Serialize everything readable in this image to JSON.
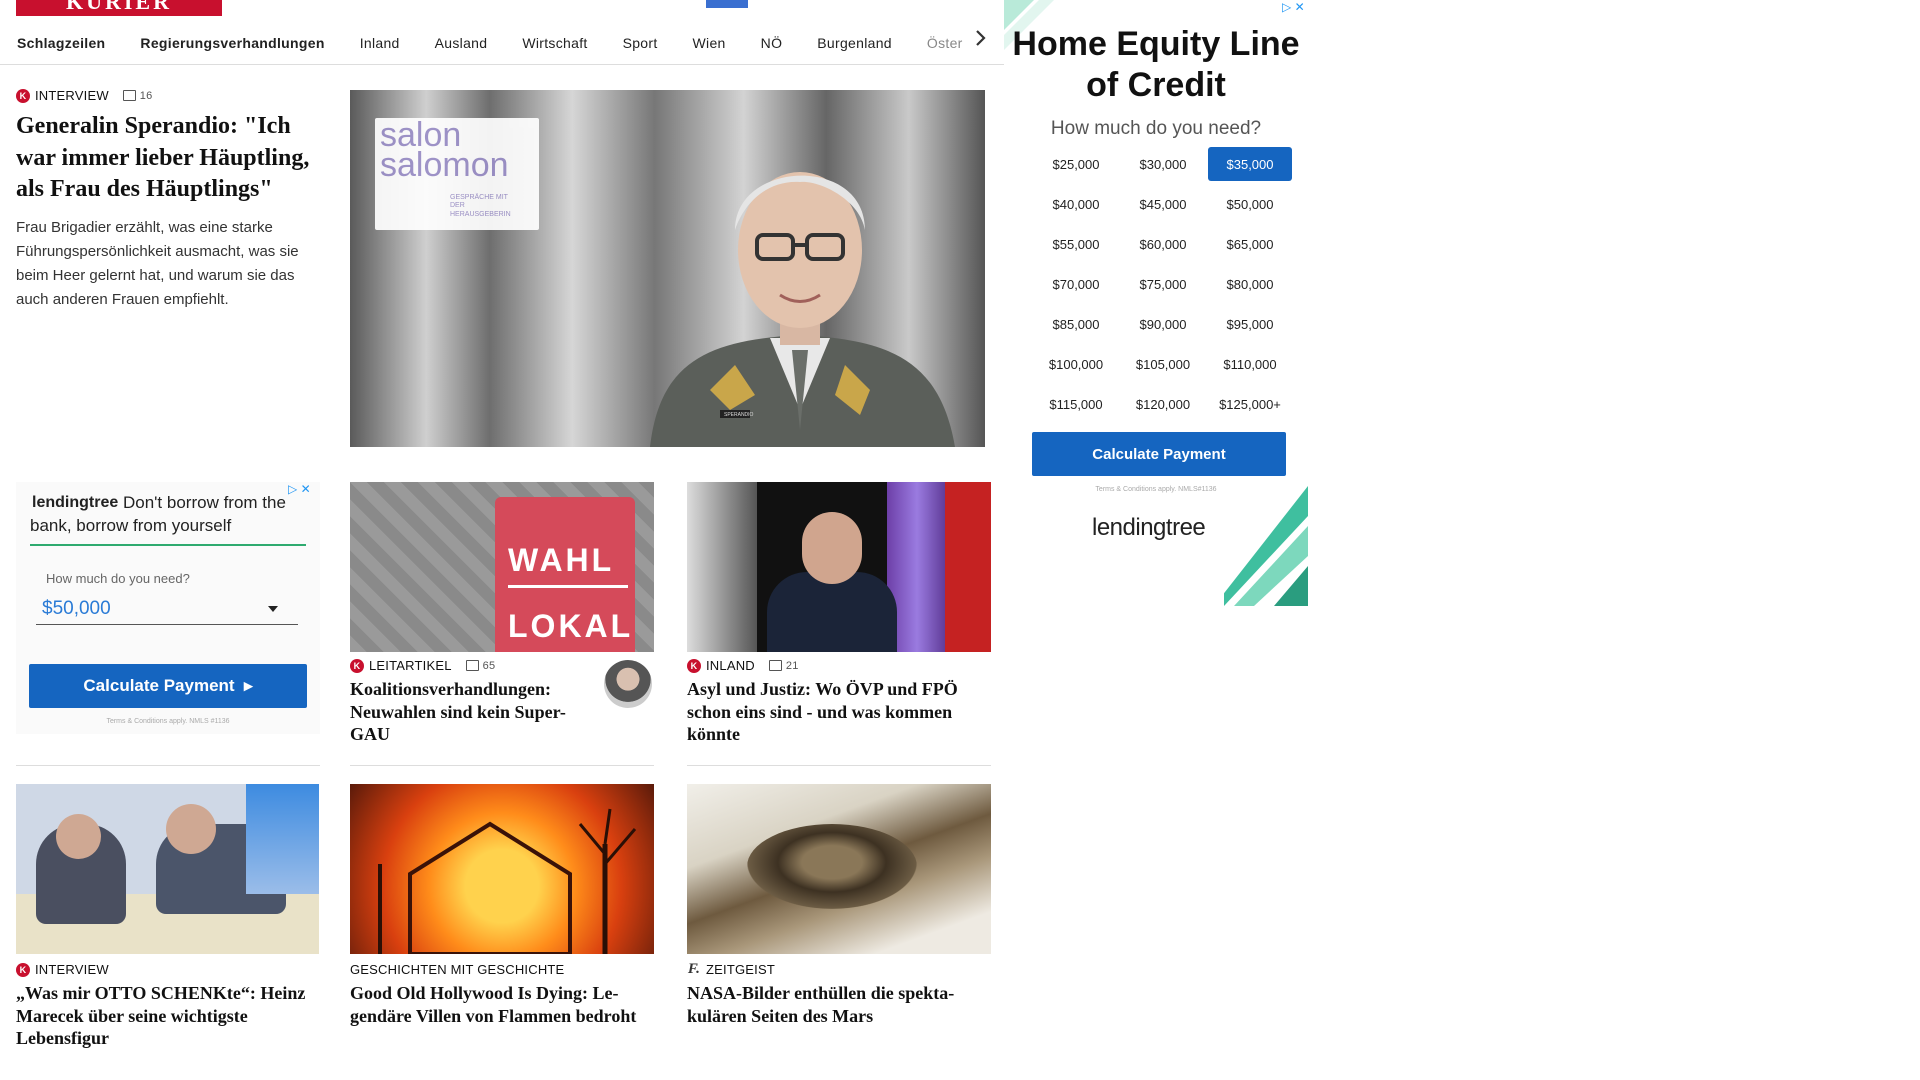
{
  "header": {
    "logo_text": "KURIER",
    "nav": [
      {
        "label": "Schlagzeilen",
        "bold": true
      },
      {
        "label": "Regierungsverhandlungen",
        "bold": true
      },
      {
        "label": "Inland"
      },
      {
        "label": "Ausland"
      },
      {
        "label": "Wirtschaft"
      },
      {
        "label": "Sport"
      },
      {
        "label": "Wien"
      },
      {
        "label": "NÖ"
      },
      {
        "label": "Burgenland"
      },
      {
        "label": "Öster"
      }
    ]
  },
  "lead": {
    "kicker": "INTERVIEW",
    "comments": "16",
    "title": "Generalin Sperandio: \"Ich war immer lieber Häupt­ling, als Frau des Häuptlings\"",
    "teaser": "Frau Brigadier erzählt, was eine starke Führungspersönlichkeit ausmacht, was sie beim Heer gelernt hat, und warum sie das auch anderen Frauen empfiehlt.",
    "image_overlay_line1": "salon",
    "image_overlay_line2": "salomon",
    "image_overlay_small": "GESPRÄCHE MIT DER HERAUSGEBERIN",
    "image_nametag": "SPERANDIO"
  },
  "articles_row1": [
    {
      "kicker": "LEITARTIKEL",
      "comments": "65",
      "title": "Koalitionsverhandlungen: Neuwahlen sind kein Su­per-GAU",
      "img_text1": "WAHL",
      "img_text2": "LOKAL"
    },
    {
      "kicker": "INLAND",
      "comments": "21",
      "title": "Asyl und Justiz: Wo ÖVP und FPÖ schon eins sind - und was kommen könnte"
    }
  ],
  "articles_row2": [
    {
      "kicker": "INTERVIEW",
      "title": "„Was mir OTTO SCHENKte“: Heinz Marecek über seine wichtigste Lebensfigur"
    },
    {
      "kicker": "GESCHICHTEN MIT GESCHICHTE",
      "title": "Good Old Hollywood Is Dying: Le­gendäre Villen von Flammen bedroht"
    },
    {
      "kicker": "ZEITGEIST",
      "title": "NASA-Bilder enthüllen die spekta­kulären Seiten des Mars"
    }
  ],
  "ad_left": {
    "brand": "lendingtree",
    "headline": "Don't borrow from the bank, borrow from yourself",
    "question": "How much do you need?",
    "amount": "$50,000",
    "button": "Calculate Payment",
    "terms": "Terms & Conditions apply. NMLS #1136"
  },
  "ad_right": {
    "headline": "Home Equity Line of Credit",
    "question": "How much do you need?",
    "amounts": [
      "$25,000",
      "$30,000",
      "$35,000",
      "$40,000",
      "$45,000",
      "$50,000",
      "$55,000",
      "$60,000",
      "$65,000",
      "$70,000",
      "$75,000",
      "$80,000",
      "$85,000",
      "$90,000",
      "$95,000",
      "$100,000",
      "$105,000",
      "$110,000",
      "$115,000",
      "$120,000",
      "$125,000+"
    ],
    "selected": "$35,000",
    "button": "Calculate Payment",
    "terms": "Terms & Conditions apply. NMLS#1136",
    "brand": "lendingtree"
  },
  "colors": {
    "brand_red": "#c8102e",
    "ad_blue": "#1565c0",
    "ad_teal": "#3fbf9f"
  }
}
